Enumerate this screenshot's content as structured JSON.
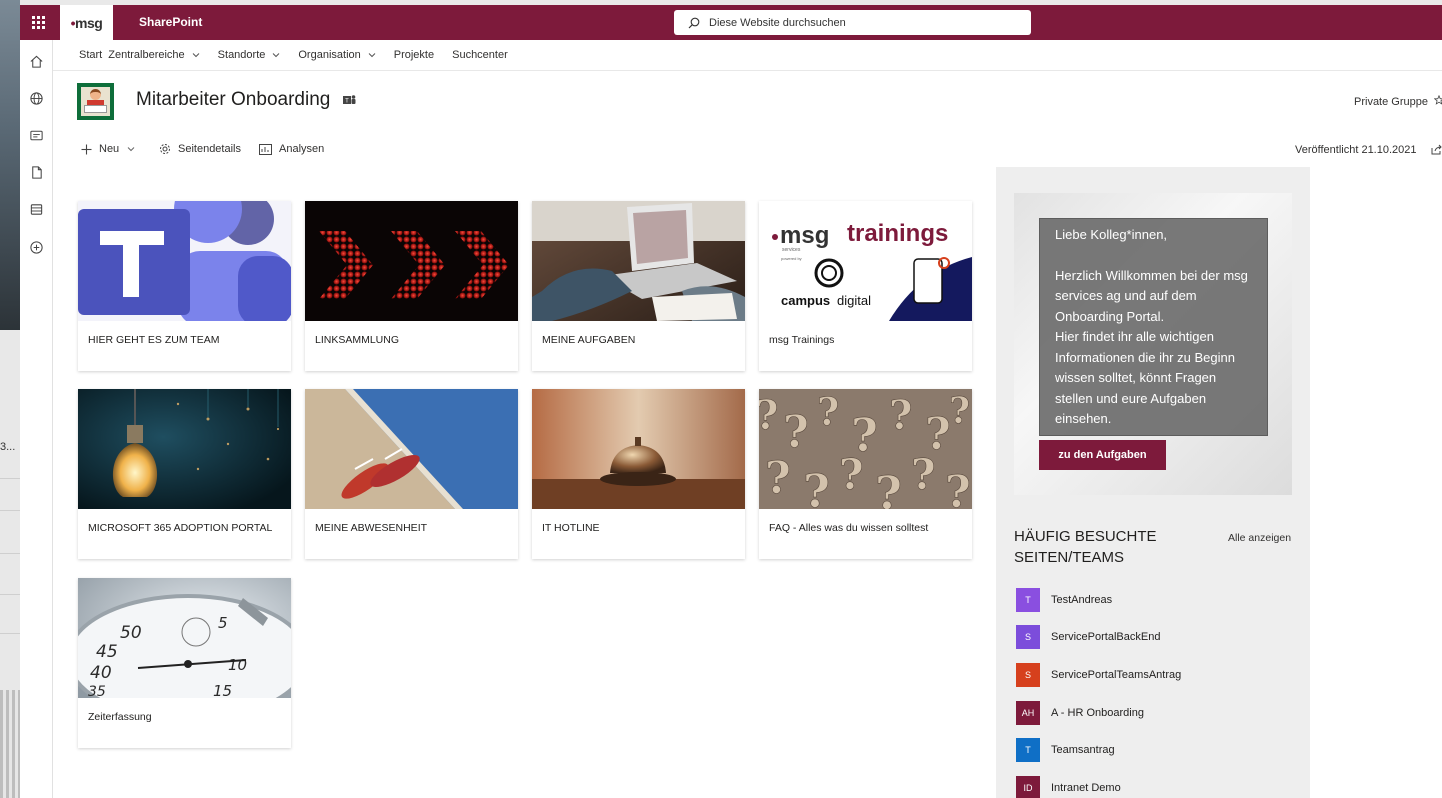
{
  "desktop": {
    "truncated_text": "3..."
  },
  "suite": {
    "app_name": "SharePoint",
    "logo_text": "msg",
    "search_placeholder": "Diese Website durchsuchen"
  },
  "hubnav": {
    "items": [
      {
        "label": "Start",
        "dropdown": false
      },
      {
        "label": "Zentralbereiche",
        "dropdown": true
      },
      {
        "label": "Standorte",
        "dropdown": true
      },
      {
        "label": "Organisation",
        "dropdown": true
      },
      {
        "label": "Projekte",
        "dropdown": false
      },
      {
        "label": "Suchcenter",
        "dropdown": false
      }
    ]
  },
  "site": {
    "title": "Mitarbeiter Onboarding",
    "privacy": "Private Gruppe",
    "published": "Veröffentlicht 21.10.2021"
  },
  "commands": {
    "new": "Neu",
    "page_details": "Seitendetails",
    "analytics": "Analysen"
  },
  "tiles": [
    {
      "label": "HIER GEHT ES ZUM TEAM",
      "image": "teams-logo"
    },
    {
      "label": "LINKSAMMLUNG",
      "image": "red-arrows"
    },
    {
      "label": "MEINE AUFGABEN",
      "image": "laptop"
    },
    {
      "label": "msg Trainings",
      "image": "msg-trainings"
    },
    {
      "label": "MICROSOFT 365 ADOPTION PORTAL",
      "image": "lightbulb"
    },
    {
      "label": "MEINE ABWESENHEIT",
      "image": "flip-flops"
    },
    {
      "label": "IT HOTLINE",
      "image": "service-bell"
    },
    {
      "label": "FAQ - Alles was du wissen solltest",
      "image": "question-marks"
    },
    {
      "label": "Zeiterfassung",
      "image": "stopwatch"
    }
  ],
  "msg_trainings_banner": {
    "brand": "msg",
    "brand_sub": "services",
    "word": "trainings",
    "powered_by": "powered by",
    "partner_a": "campus",
    "partner_b": "digital"
  },
  "welcome": {
    "greeting": "Liebe Kolleg*innen,",
    "body_1": "Herzlich Willkommen bei der msg services ag und auf dem Onboarding Portal.",
    "body_2": "Hier findet ihr alle wichtigen Informationen die ihr zu Beginn wissen solltet, könnt Fragen stellen und eure Aufgaben einsehen.",
    "button": "zu den Aufgaben"
  },
  "frequent": {
    "title": "HÄUFIG BESUCHTE SEITEN/TEAMS",
    "show_all": "Alle anzeigen",
    "sites": [
      {
        "initials": "T",
        "name": "TestAndreas",
        "color": "#8a4fe0"
      },
      {
        "initials": "S",
        "name": "ServicePortalBackEnd",
        "color": "#7c4ddb"
      },
      {
        "initials": "S",
        "name": "ServicePortalTeamsAntrag",
        "color": "#d6401d"
      },
      {
        "initials": "AH",
        "name": "A - HR Onboarding",
        "color": "#7d1a3b"
      },
      {
        "initials": "T",
        "name": "Teamsantrag",
        "color": "#0f6fc6"
      },
      {
        "initials": "ID",
        "name": "Intranet Demo",
        "color": "#7d1a3b"
      }
    ]
  },
  "colors": {
    "brand": "#7d1a3b",
    "suite_bar": "#7d1a3b"
  }
}
